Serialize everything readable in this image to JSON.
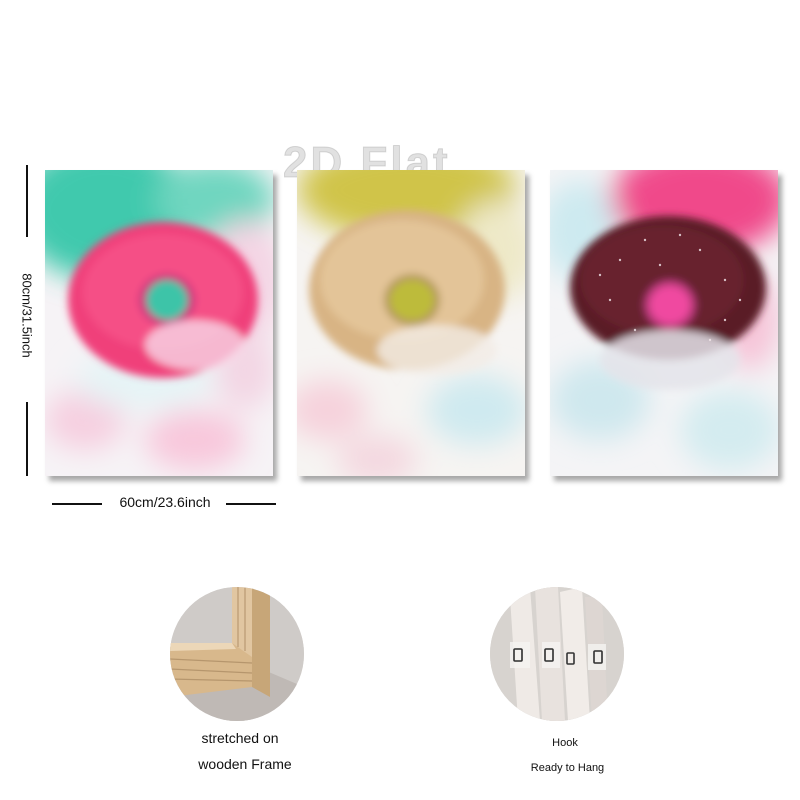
{
  "watermark": "2D Flat",
  "dimensions": {
    "height_label": "80cm/31.5inch",
    "width_label": "60cm/23.6inch"
  },
  "panels": [
    {
      "name": "pink-donut-panel",
      "donut_color": "#f0407a",
      "hole_color": "#3cc4a8",
      "background_accent": "#3ec8ad"
    },
    {
      "name": "glazed-donut-panel",
      "donut_color": "#d8b484",
      "hole_color": "#bdbb3a",
      "background_accent": "#cfc24a"
    },
    {
      "name": "chocolate-donut-panel",
      "donut_color": "#5a1a26",
      "hole_color": "#f04aa0",
      "background_accent": "#f04a8a"
    }
  ],
  "features": [
    {
      "caption_line1": "stretched on",
      "caption_line2": "wooden Frame",
      "icon": "wooden-frame-photo"
    },
    {
      "caption_line1": "Hook",
      "caption_line2": "Ready to Hang",
      "icon": "hook-photo"
    }
  ]
}
